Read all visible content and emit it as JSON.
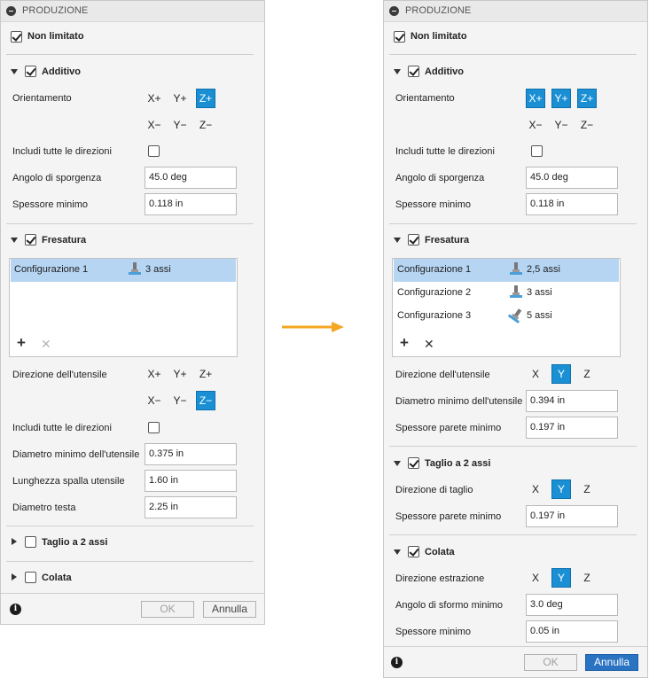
{
  "left": {
    "title": "PRODUZIONE",
    "non_limitato": "Non limitato",
    "additivo": {
      "label": "Additivo",
      "orientamento": "Orientamento",
      "x_plus": "X+",
      "y_plus": "Y+",
      "z_plus": "Z+",
      "x_minus": "X−",
      "y_minus": "Y−",
      "z_minus": "Z−",
      "includi": "Includi tutte le direzioni",
      "angolo_label": "Angolo di sporgenza",
      "angolo_value": "45.0 deg",
      "spessore_label": "Spessore minimo",
      "spessore_value": "0.118 in"
    },
    "fresatura": {
      "label": "Fresatura",
      "configs": [
        {
          "name": "Configurazione 1",
          "value": "3 assi"
        }
      ],
      "direzione": "Direzione dell'utensile",
      "x_plus": "X+",
      "y_plus": "Y+",
      "z_plus": "Z+",
      "x_minus": "X−",
      "y_minus": "Y−",
      "z_minus": "Z−",
      "includi": "Includi tutte le direzioni",
      "diametro_label": "Diametro minimo dell'utensile",
      "diametro_value": "0.375 in",
      "lunghezza_label": "Lunghezza spalla utensile",
      "lunghezza_value": "1.60 in",
      "testa_label": "Diametro testa",
      "testa_value": "2.25 in"
    },
    "taglio": {
      "label": "Taglio a 2 assi"
    },
    "colata": {
      "label": "Colata"
    },
    "ok": "OK",
    "annulla": "Annulla"
  },
  "right": {
    "title": "PRODUZIONE",
    "non_limitato": "Non limitato",
    "additivo": {
      "label": "Additivo",
      "orientamento": "Orientamento",
      "x_plus": "X+",
      "y_plus": "Y+",
      "z_plus": "Z+",
      "x_minus": "X−",
      "y_minus": "Y−",
      "z_minus": "Z−",
      "includi": "Includi tutte le direzioni",
      "angolo_label": "Angolo di sporgenza",
      "angolo_value": "45.0 deg",
      "spessore_label": "Spessore minimo",
      "spessore_value": "0.118 in"
    },
    "fresatura": {
      "label": "Fresatura",
      "configs": [
        {
          "name": "Configurazione 1",
          "value": "2,5 assi"
        },
        {
          "name": "Configurazione 2",
          "value": "3 assi"
        },
        {
          "name": "Configurazione 3",
          "value": "5 assi"
        }
      ],
      "direzione": "Direzione dell'utensile",
      "x": "X",
      "y": "Y",
      "z": "Z",
      "diametro_label": "Diametro minimo dell'utensile",
      "diametro_value": "0.394 in",
      "spessore_label": "Spessore parete minimo",
      "spessore_value": "0.197 in"
    },
    "taglio": {
      "label": "Taglio a 2 assi",
      "direzione": "Direzione di taglio",
      "x": "X",
      "y": "Y",
      "z": "Z",
      "spessore_label": "Spessore parete minimo",
      "spessore_value": "0.197 in"
    },
    "colata": {
      "label": "Colata",
      "direzione": "Direzione estrazione",
      "x": "X",
      "y": "Y",
      "z": "Z",
      "angolo_label": "Angolo di sformo minimo",
      "angolo_value": "3.0 deg",
      "spessore_label": "Spessore minimo",
      "spessore_value": "0.05 in"
    },
    "ok": "OK",
    "annulla": "Annulla"
  },
  "colors": {
    "accent": "#1b8fd4",
    "selection": "#b6d5f3",
    "arrow": "#f5a623",
    "primary_button": "#2a73c2"
  }
}
